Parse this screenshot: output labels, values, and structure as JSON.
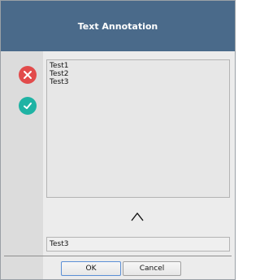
{
  "dialog": {
    "title": "Text Annotation"
  },
  "icons": {
    "reject": "close-icon",
    "accept": "check-icon"
  },
  "textarea": {
    "lines": [
      "Test1",
      "Test2",
      "Test3"
    ]
  },
  "input": {
    "value": "Test3"
  },
  "buttons": {
    "ok_label": "OK",
    "cancel_label": "Cancel"
  },
  "colors": {
    "titlebar": "#4a6a8a",
    "reject": "#e24b4b",
    "accept": "#1fb3a4"
  }
}
